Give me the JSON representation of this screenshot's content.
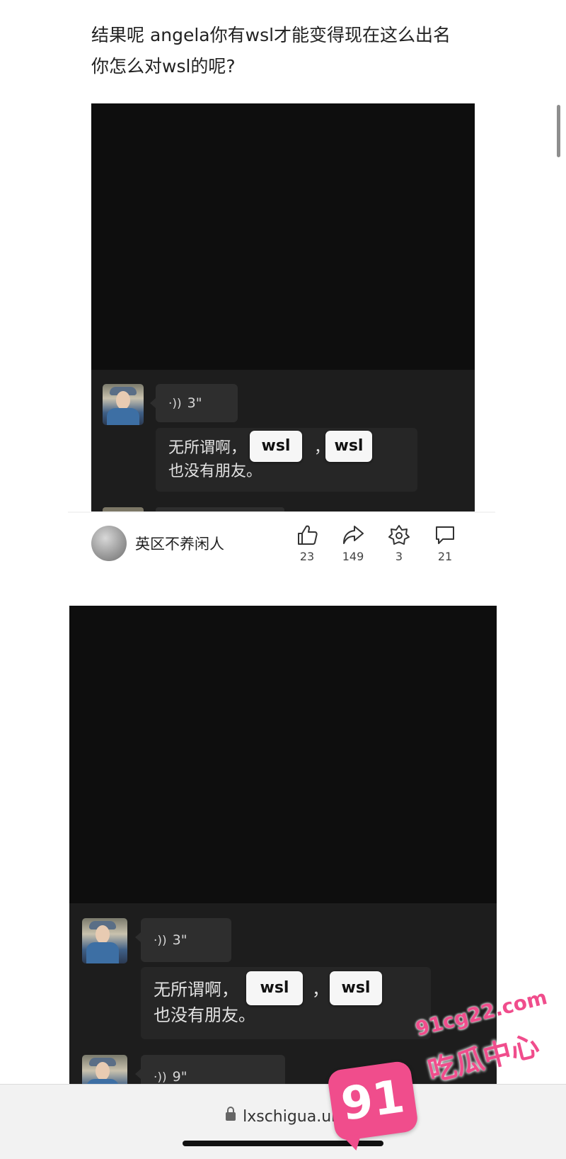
{
  "post": {
    "text": "结果呢 angela你有wsl才能变得现在这么出名 你怎么对wsl的呢?"
  },
  "screenshot1": {
    "voice_duration": "3\"",
    "transcript": "无所谓啊，",
    "transcript_mid": "，",
    "transcript_end": "也没有朋友。",
    "tag1": "wsl",
    "tag2": "wsl"
  },
  "author": {
    "name": "英区不养闲人"
  },
  "stats": {
    "likes": "23",
    "shares": "149",
    "collects": "3",
    "comments": "21"
  },
  "screenshot2": {
    "voice_duration": "3\"",
    "transcript": "无所谓啊，",
    "transcript_mid": "，",
    "transcript_end": "也没有朋友。",
    "tag1": "wsl",
    "tag2": "wsl",
    "voice2_duration": "9\""
  },
  "browser": {
    "url": "lxschigua.uk"
  },
  "watermark": {
    "badge": "91",
    "site": "91cg22.com",
    "name": "吃瓜中心"
  },
  "colors": {
    "watermark_pink": "#f04d8c",
    "dark_bg": "#0e0e0e",
    "chat_bg": "#1d1d1d"
  }
}
